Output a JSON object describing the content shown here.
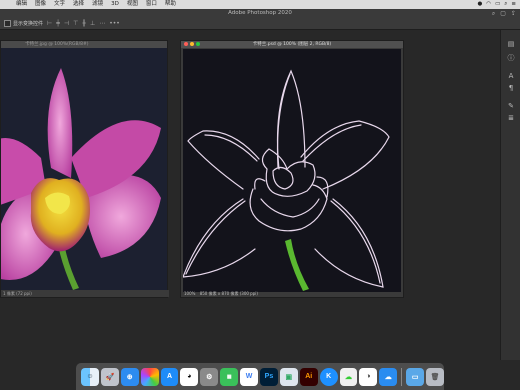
{
  "menubar": {
    "apple_icon": "apple-icon",
    "items": [
      "编辑",
      "图像",
      "文字",
      "选择",
      "滤镜",
      "3D",
      "视图",
      "窗口",
      "帮助"
    ]
  },
  "window": {
    "title": "Adobe Photoshop 2020"
  },
  "options_bar": {
    "auto_select_label": "显示变换控件"
  },
  "doc_left": {
    "tab_title": "卡特兰.jpg @ 100%(RGB/8#)",
    "status": "1 像素 (72 ppi)"
  },
  "doc_right": {
    "tab_title": "卡特兰.psd @ 100% (图层 2, RGB/8)",
    "status_zoom": "100%",
    "status_info": "850 像素 x 870 像素 (300 ppi)"
  },
  "dock": {
    "icons": [
      "finder",
      "launchpad",
      "safari",
      "photos",
      "appstore",
      "qq",
      "systemprefs",
      "wechat-work",
      "wps",
      "photoshop",
      "preview",
      "illustrator",
      "kugou",
      "wechat",
      "qq-music",
      "baidu-netdisk",
      "folder",
      "trash"
    ]
  },
  "colors": {
    "accent": "#2d8cf0",
    "photoshop_blue": "#31a8ff",
    "illustrator_orange": "#ff9a00"
  }
}
